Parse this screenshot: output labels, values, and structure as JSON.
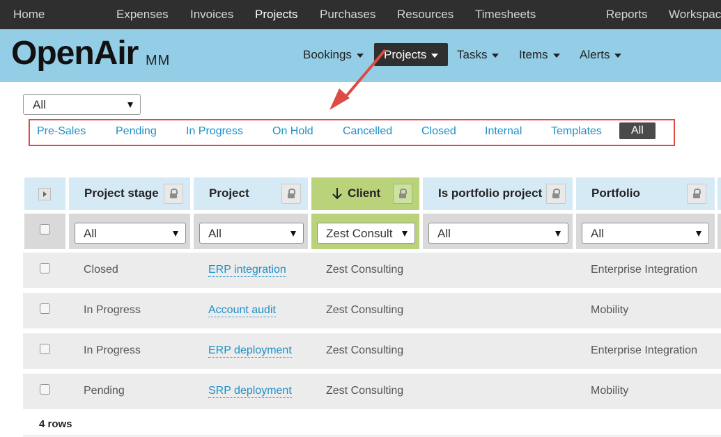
{
  "top_nav": {
    "items": [
      "Home",
      "Expenses",
      "Invoices",
      "Projects",
      "Purchases",
      "Resources",
      "Timesheets",
      "Reports",
      "Workspaces"
    ],
    "active": "Projects"
  },
  "header": {
    "logo": "OpenAir",
    "logo_suffix": "MM",
    "subnav": [
      "Bookings",
      "Projects",
      "Tasks",
      "Items",
      "Alerts"
    ],
    "active": "Projects"
  },
  "view_select": {
    "value": "All"
  },
  "stage_filter": {
    "items": [
      "Pre-Sales",
      "Pending",
      "In Progress",
      "On Hold",
      "Cancelled",
      "Closed",
      "Internal",
      "Templates",
      "All"
    ],
    "active": "All"
  },
  "table": {
    "columns": [
      {
        "label": "Project stage",
        "sorted": false
      },
      {
        "label": "Project",
        "sorted": false
      },
      {
        "label": "Client",
        "sorted": true,
        "sort_icon": "arrow-down-icon"
      },
      {
        "label": "Is portfolio project",
        "sorted": false
      },
      {
        "label": "Portfolio",
        "sorted": false
      }
    ],
    "filters": [
      "All",
      "All",
      "Zest Consult",
      "All",
      "All"
    ],
    "rows": [
      {
        "stage": "Closed",
        "project": "ERP integration",
        "client": "Zest Consulting",
        "is_portfolio": "",
        "portfolio": "Enterprise Integration"
      },
      {
        "stage": "In Progress",
        "project": "Account audit",
        "client": "Zest Consulting",
        "is_portfolio": "",
        "portfolio": "Mobility"
      },
      {
        "stage": "In Progress",
        "project": "ERP deployment",
        "client": "Zest Consulting",
        "is_portfolio": "",
        "portfolio": "Enterprise Integration"
      },
      {
        "stage": "Pending",
        "project": "SRP deployment",
        "client": "Zest Consulting",
        "is_portfolio": "",
        "portfolio": "Mobility"
      }
    ],
    "row_count": "4 rows"
  },
  "colors": {
    "top_nav_bg": "#2f2f2f",
    "header_bg": "#94cde6",
    "link": "#1e8fc8",
    "sorted_column": "#bad27a",
    "annotation": "#de4a44"
  }
}
